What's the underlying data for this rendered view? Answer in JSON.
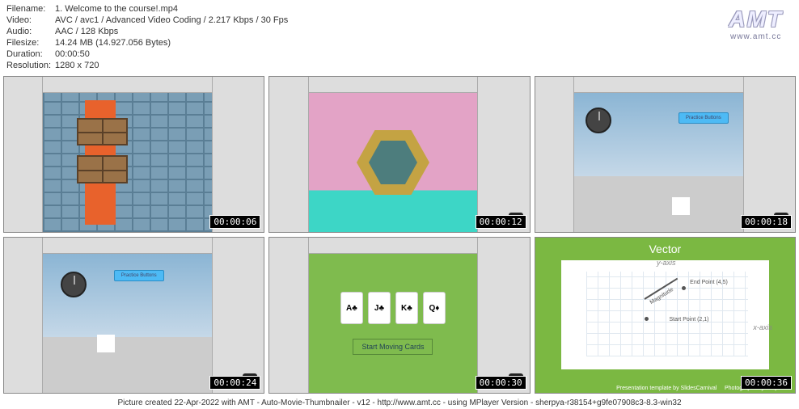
{
  "meta": {
    "filename_label": "Filename:",
    "filename": "1. Welcome to the course!.mp4",
    "video_label": "Video:",
    "video": "AVC / avc1 / Advanced Video Coding / 2.217 Kbps / 30 Fps",
    "audio_label": "Audio:",
    "audio": "AAC / 128 Kbps",
    "filesize_label": "Filesize:",
    "filesize": "14.24 MB (14.927.056 Bytes)",
    "duration_label": "Duration:",
    "duration": "00:00:50",
    "resolution_label": "Resolution:",
    "resolution": "1280 x 720"
  },
  "logo": {
    "text": "AMT",
    "sub": "www.amt.cc"
  },
  "thumbs": [
    {
      "timestamp": "00:00:06"
    },
    {
      "timestamp": "00:00:12"
    },
    {
      "timestamp": "00:00:18"
    },
    {
      "timestamp": "00:00:24"
    },
    {
      "timestamp": "00:00:30"
    },
    {
      "timestamp": "00:00:36"
    }
  ],
  "scene3": {
    "button": "Practice Buttons"
  },
  "scene4": {
    "button": "Practice Buttons"
  },
  "scene5": {
    "cards": [
      "A♣",
      "J♣",
      "K♣",
      "Q♦"
    ],
    "button": "Start Moving Cards"
  },
  "scene6": {
    "title": "Vector",
    "yaxis": "y-axis",
    "xaxis": "x-axis",
    "magnitude": "Magnitude",
    "endpoint": "End Point (4,5)",
    "startpoint": "Start Point (2,1)",
    "footer_left": "Presentation template by SlidesCarnival",
    "footer_right": "Photographs by unsplash"
  },
  "chart_data": {
    "type": "line",
    "title": "Vector",
    "xlabel": "x-axis",
    "ylabel": "y-axis",
    "series": [
      {
        "name": "Vector",
        "x": [
          2,
          4
        ],
        "y": [
          1,
          5
        ]
      }
    ],
    "annotations": [
      "Start Point (2,1)",
      "End Point (4,5)",
      "Magnitude"
    ],
    "xlim": [
      -2,
      8
    ],
    "ylim": [
      -2,
      8
    ]
  },
  "footer": "Picture created 22-Apr-2022 with AMT - Auto-Movie-Thumbnailer - v12 - http://www.amt.cc - using MPlayer Version - sherpya-r38154+g9fe07908c3-8.3-win32"
}
